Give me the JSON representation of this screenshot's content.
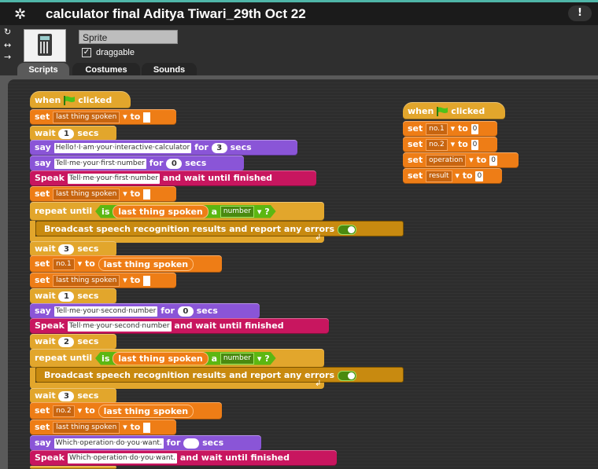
{
  "window": {
    "title": "calculator final Aditya Tiwari_29th Oct 22",
    "menu_glyph": "!"
  },
  "sprite": {
    "name": "Sprite",
    "draggable_label": "draggable",
    "draggable_checked": "✓"
  },
  "tabs": [
    {
      "label": "Scripts"
    },
    {
      "label": "Costumes"
    },
    {
      "label": "Sounds"
    }
  ],
  "colors": {
    "control": "#e2a62c",
    "variables": "#ee7d16",
    "looks": "#8a55d7",
    "speech": "#c8165f",
    "operators": "#5cb712"
  },
  "script1": {
    "hat": "when",
    "hat2": "clicked",
    "lines": {
      "set": "set",
      "to": "to",
      "wait": "wait",
      "secs": "secs",
      "say": "say",
      "for": "for",
      "speak": "Speak",
      "and_wait": "and wait until finished",
      "repeat_until": "repeat until",
      "is": "is",
      "a": "a",
      "q": "?",
      "broadcast": "Broadcast speech recognition results and report any errors"
    },
    "var_last": "last thing spoken",
    "var_num1": "no.1",
    "var_num2": "no.2",
    "number_type": "number",
    "reporter_last": "last thing spoken",
    "wait_1": "1",
    "wait_3": "3",
    "wait_2": "2",
    "say1": "Hello!·I·am·your·interactive·calculator",
    "say1_secs": "3",
    "say2": "Tell·me·your·first·number",
    "say2_secs": "0",
    "speak1": "Tell·me·your·first·number",
    "say3": "Tell·me·your·second·number",
    "say3_secs": "0",
    "speak2": "Tell·me·your·second·number",
    "say4": "Which·operation·do·you·want.",
    "speak3": "Which·operation·do·you·want."
  },
  "script2": {
    "hat": "when",
    "hat2": "clicked",
    "set": "set",
    "to": "to",
    "vars": [
      "no.1",
      "no.2",
      "operation",
      "result"
    ],
    "values": [
      "0",
      "0",
      "0",
      "0"
    ]
  }
}
